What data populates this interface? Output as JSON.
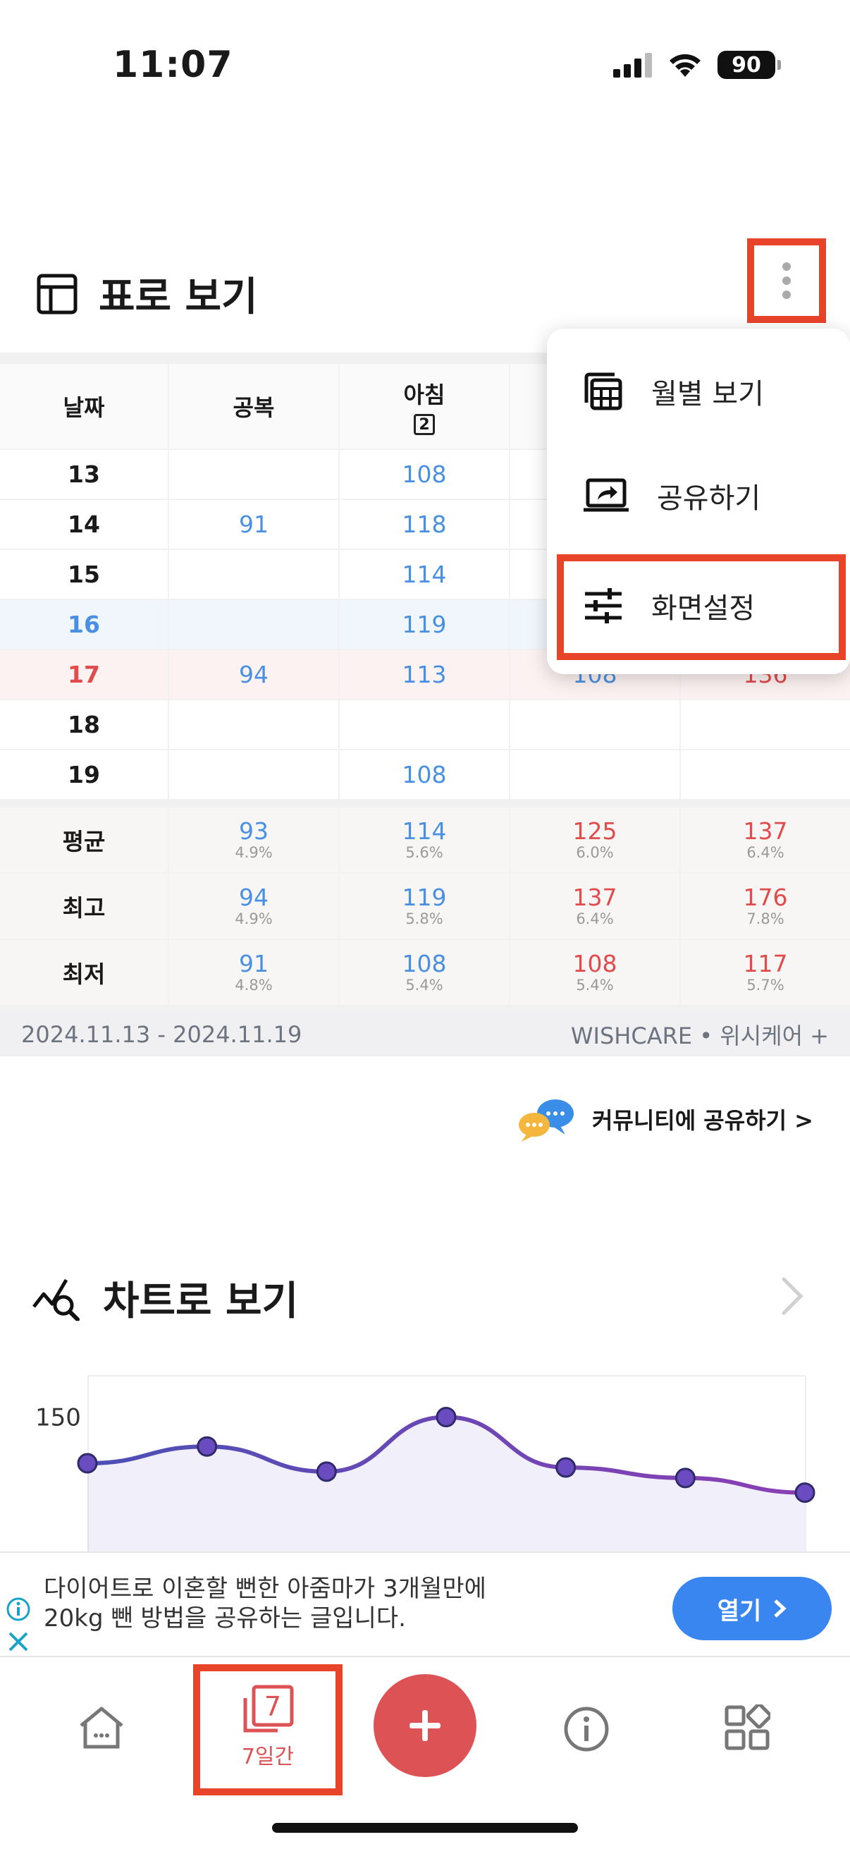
{
  "status": {
    "time": "11:07",
    "battery": "90"
  },
  "table_section": {
    "title": "표로 보기",
    "columns": [
      "날짜",
      "공복",
      "아침"
    ],
    "breakfast_badge": "2",
    "rows": [
      {
        "date": "13",
        "fasting": "",
        "breakfast": "108",
        "c3": "",
        "c4": ""
      },
      {
        "date": "14",
        "fasting": "91",
        "breakfast": "118",
        "c3": "",
        "c4": ""
      },
      {
        "date": "15",
        "fasting": "",
        "breakfast": "114",
        "c3": "",
        "c4": ""
      },
      {
        "date": "16",
        "fasting": "",
        "breakfast": "119",
        "c3": "",
        "c4": ""
      },
      {
        "date": "17",
        "fasting": "94",
        "breakfast": "113",
        "c3": "108",
        "c4": "136"
      },
      {
        "date": "18",
        "fasting": "",
        "breakfast": "",
        "c3": "",
        "c4": ""
      },
      {
        "date": "19",
        "fasting": "",
        "breakfast": "108",
        "c3": "",
        "c4": ""
      }
    ],
    "summary": [
      {
        "label": "평균",
        "vals": [
          [
            "93",
            "4.9%"
          ],
          [
            "114",
            "5.6%"
          ],
          [
            "125",
            "6.0%"
          ],
          [
            "137",
            "6.4%"
          ]
        ]
      },
      {
        "label": "최고",
        "vals": [
          [
            "94",
            "4.9%"
          ],
          [
            "119",
            "5.8%"
          ],
          [
            "137",
            "6.4%"
          ],
          [
            "176",
            "7.8%"
          ]
        ]
      },
      {
        "label": "최저",
        "vals": [
          [
            "91",
            "4.8%"
          ],
          [
            "108",
            "5.4%"
          ],
          [
            "108",
            "5.4%"
          ],
          [
            "117",
            "5.7%"
          ]
        ]
      }
    ],
    "date_range": "2024.11.13 - 2024.11.19",
    "brand": "WISHCARE • 위시케어 +"
  },
  "menu": {
    "items": [
      "월별 보기",
      "공유하기",
      "화면설정"
    ]
  },
  "community_link": "커뮤니티에 공유하기 >",
  "chart_section": {
    "title": "차트로 보기"
  },
  "chart_data": {
    "type": "line",
    "y_tick_labels": [
      "150"
    ],
    "ylim": [
      118,
      160
    ],
    "x": [
      1,
      2,
      3,
      4,
      5,
      6,
      7
    ],
    "series": [
      {
        "values": [
          139,
          143,
          137,
          150,
          138,
          135.5,
          132
        ]
      }
    ],
    "grid": false
  },
  "ad": {
    "line1": "다이어트로 이혼할 뻔한 아줌마가 3개월만에",
    "line2": "20kg 뺀 방법을 공유하는 글입니다.",
    "button": "열기"
  },
  "nav": {
    "seven_days_badge": "7",
    "seven_days_label": "7일간"
  },
  "colors": {
    "accent_red": "#e8442a",
    "blue": "#4a90e2",
    "red": "#e24b4b",
    "chart_line": "#5b45b0",
    "ad_button": "#3a86f0",
    "fab": "#dc5255"
  }
}
